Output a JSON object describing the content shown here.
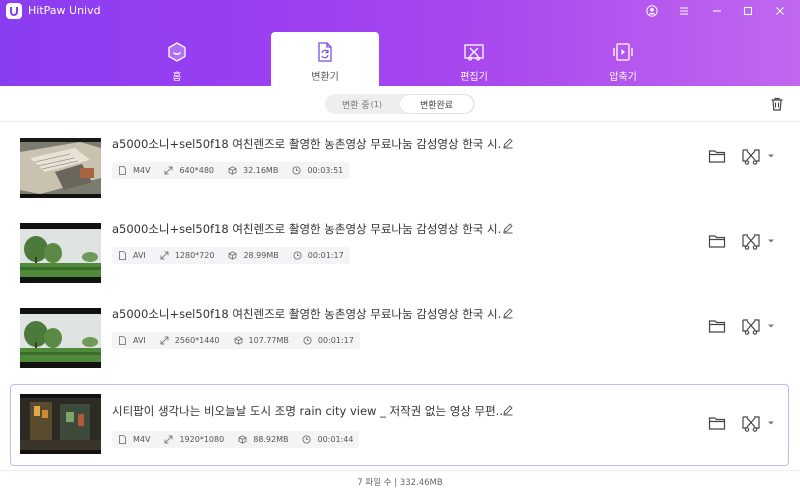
{
  "app": {
    "title": "HitPaw Univd"
  },
  "tabs": [
    {
      "label": "홈"
    },
    {
      "label": "변환기"
    },
    {
      "label": "편집기"
    },
    {
      "label": "압축기"
    }
  ],
  "segment": {
    "left_label": "변환 중",
    "left_count": "(1)",
    "right_label": "변환완료"
  },
  "files": [
    {
      "name": "a5000소니+sel50f18 여친렌즈로 촬영한 농촌영상 무료나눔 감성영상 한국 시...",
      "format": "M4V",
      "resolution": "640*480",
      "size": "32.16MB",
      "duration": "00:03:51"
    },
    {
      "name": "a5000소니+sel50f18 여친렌즈로 촬영한 농촌영상 무료나눔 감성영상 한국 시...",
      "format": "AVI",
      "resolution": "1280*720",
      "size": "28.99MB",
      "duration": "00:01:17"
    },
    {
      "name": "a5000소니+sel50f18 여친렌즈로 촬영한 농촌영상 무료나눔 감성영상 한국 시...",
      "format": "AVI",
      "resolution": "2560*1440",
      "size": "107.77MB",
      "duration": "00:01:17"
    },
    {
      "name": "시티팝이 생각나는 비오늘날 도시 조명 rain city view _ 저작권 없는 영상 무편...",
      "format": "M4V",
      "resolution": "1920*1080",
      "size": "88.92MB",
      "duration": "00:01:44"
    }
  ],
  "footer": {
    "summary": "7 파일 수 | 332.46MB"
  },
  "colors": {
    "accent": "#9b3ff2",
    "selected_border": "#b9bdf5"
  }
}
